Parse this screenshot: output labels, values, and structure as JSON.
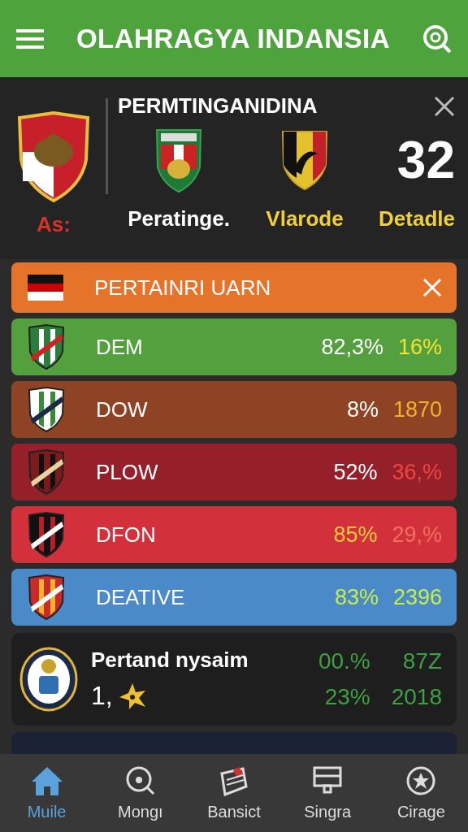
{
  "app_bar": {
    "title": "OLAHRAGYA INDANSIA"
  },
  "match": {
    "title": "PERMTINGANIDINA",
    "score": "32",
    "labels": [
      {
        "text": "As:",
        "color": "#d9302c"
      },
      {
        "text": "Peratinge.",
        "color": "#ffffff"
      },
      {
        "text": "Vlarode",
        "color": "#f0cf3a"
      },
      {
        "text": "Detadle",
        "color": "#f0cf3a"
      }
    ]
  },
  "rows": [
    {
      "kind": "banner",
      "name": "PERTAINRI UARN",
      "color": "#e5742a",
      "values": []
    },
    {
      "kind": "stat",
      "name": "DEM",
      "color": "#55a03e",
      "values": [
        {
          "text": "82,3%",
          "color": "#ffffff"
        },
        {
          "text": "16%",
          "color": "#f2e230"
        }
      ]
    },
    {
      "kind": "stat",
      "name": "DOW",
      "color": "#8e4325",
      "values": [
        {
          "text": "8%",
          "color": "#ffffff"
        },
        {
          "text": "1870",
          "color": "#f2b32a"
        }
      ]
    },
    {
      "kind": "stat",
      "name": "PLOW",
      "color": "#96202a",
      "values": [
        {
          "text": "52%",
          "color": "#ffffff"
        },
        {
          "text": "36,%",
          "color": "#f0443c"
        }
      ]
    },
    {
      "kind": "stat",
      "name": "DFON",
      "color": "#d2303a",
      "values": [
        {
          "text": "85%",
          "color": "#f3cc3c"
        },
        {
          "text": "29,%",
          "color": "#f07060"
        }
      ]
    },
    {
      "kind": "stat",
      "name": "DEATIVE",
      "color": "#4a8ac8",
      "values": [
        {
          "text": "83%",
          "color": "#c8f040"
        },
        {
          "text": "2396",
          "color": "#c8f040"
        }
      ]
    }
  ],
  "card": {
    "title": "Pertand nysaim",
    "subtitle": "1,",
    "values": [
      {
        "text": "00.%"
      },
      {
        "text": "87Z"
      },
      {
        "text": "23%"
      },
      {
        "text": "2018"
      }
    ]
  },
  "nav": [
    {
      "label": "Muile",
      "selected": true
    },
    {
      "label": "Mongı",
      "selected": false
    },
    {
      "label": "Bansict",
      "selected": false
    },
    {
      "label": "Singra",
      "selected": false
    },
    {
      "label": "Cirage",
      "selected": false
    }
  ]
}
